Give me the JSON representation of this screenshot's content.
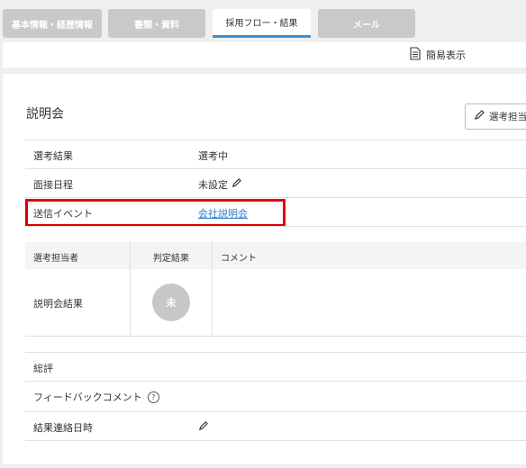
{
  "tabs": [
    {
      "label": "基本情報・経歴情報"
    },
    {
      "label": "書類・資料"
    },
    {
      "label": "採用フロー・結果"
    },
    {
      "label": "メール"
    }
  ],
  "toolbar": {
    "simple_view_label": "簡易表示",
    "icon": "document-icon"
  },
  "section": {
    "title": "説明会",
    "assign_button_label": "選考担当",
    "rows": [
      {
        "label": "選考結果",
        "value": "選考中"
      },
      {
        "label": "面接日程",
        "value": "未設定"
      },
      {
        "label": "送信イベント",
        "value": "会社説明会"
      }
    ]
  },
  "evaluation": {
    "headers": {
      "assignee": "選考担当者",
      "judgement": "判定結果",
      "comment": "コメント"
    },
    "row_label": "説明会結果",
    "badge": "未"
  },
  "summary_rows": [
    {
      "label": "総評"
    },
    {
      "label": "フィードバックコメント"
    },
    {
      "label": "結果連絡日時"
    }
  ],
  "colors": {
    "active_tab_underline": "#3a8fd0",
    "highlight": "#e00000",
    "link": "#2a7bd0",
    "badge": "#c7c7c7"
  }
}
